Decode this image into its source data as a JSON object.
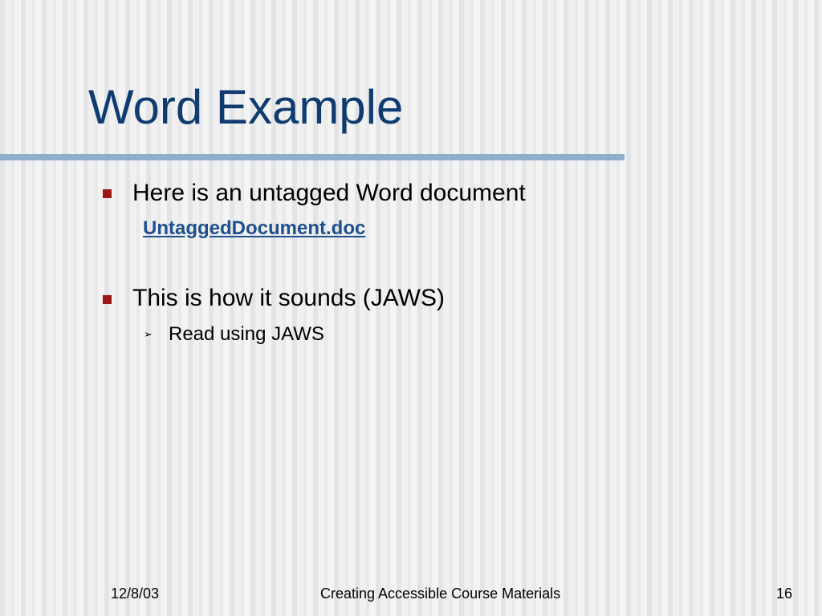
{
  "slide": {
    "title": "Word Example",
    "bullets": [
      {
        "text": "Here is an untagged Word document",
        "link": "UntaggedDocument.doc"
      },
      {
        "text": "This is how it sounds (JAWS)",
        "sub": "Read using JAWS"
      }
    ],
    "footer": {
      "date": "12/8/03",
      "center": "Creating Accessible Course Materials",
      "page": "16"
    }
  },
  "colors": {
    "title": "#0f3c70",
    "rule": "#8faecc",
    "bullet": "#a01515",
    "link": "#1f4f8f"
  },
  "icons": {
    "bullet": "square-bullet-icon",
    "sub_bullet": "arrow-bullet-icon"
  }
}
